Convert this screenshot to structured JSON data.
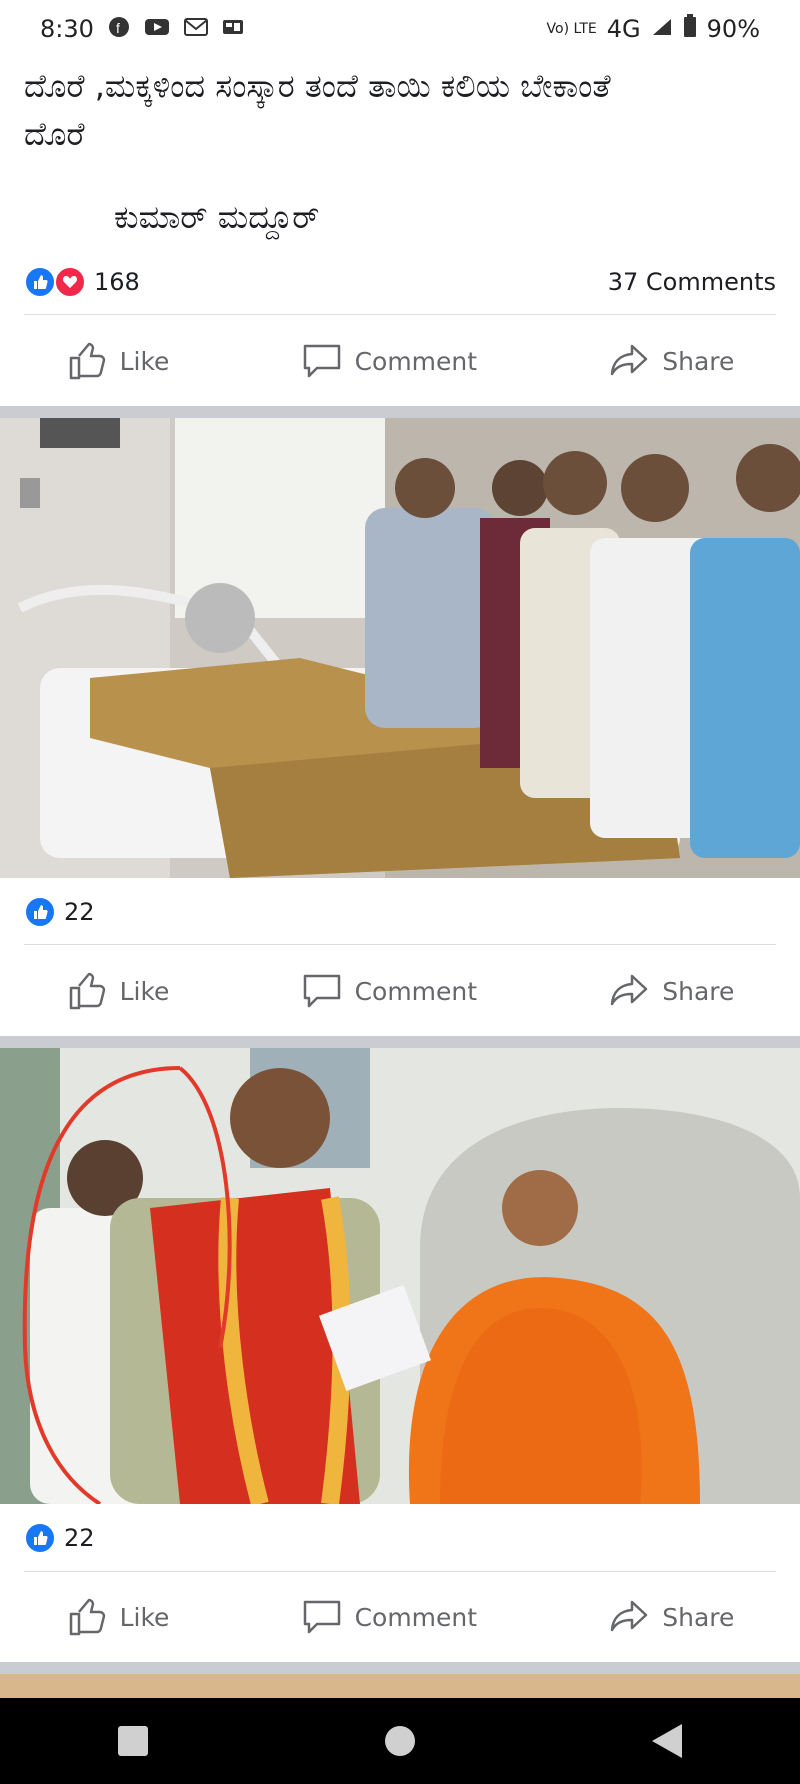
{
  "status_bar": {
    "time": "8:30",
    "network": "4G",
    "battery": "90%",
    "lte": "Vo) LTE",
    "icons": [
      "facebook-icon",
      "youtube-icon",
      "gmail-icon",
      "gallery-icon"
    ]
  },
  "post": {
    "text_line1": "ದೊರೆ ,ಮಕ್ಕಳಿಂದ ಸಂಸ್ಕಾರ ತಂದೆ ತಾಯಿ ಕಲಿಯ ಬೇಕಾಂತೆ",
    "text_line2": "ದೊರೆ",
    "author": "ಕುಮಾರ್ ಮದ್ದೂರ್",
    "reactions_count": "168",
    "comments_count": "37 Comments"
  },
  "photo1": {
    "reactions_count": "22"
  },
  "photo2": {
    "reactions_count": "22"
  },
  "actions": {
    "like": "Like",
    "comment": "Comment",
    "share": "Share"
  },
  "colors": {
    "accent": "#1877f2",
    "love": "#f0284a",
    "robe": "#f07418",
    "divider": "#dadde1"
  }
}
